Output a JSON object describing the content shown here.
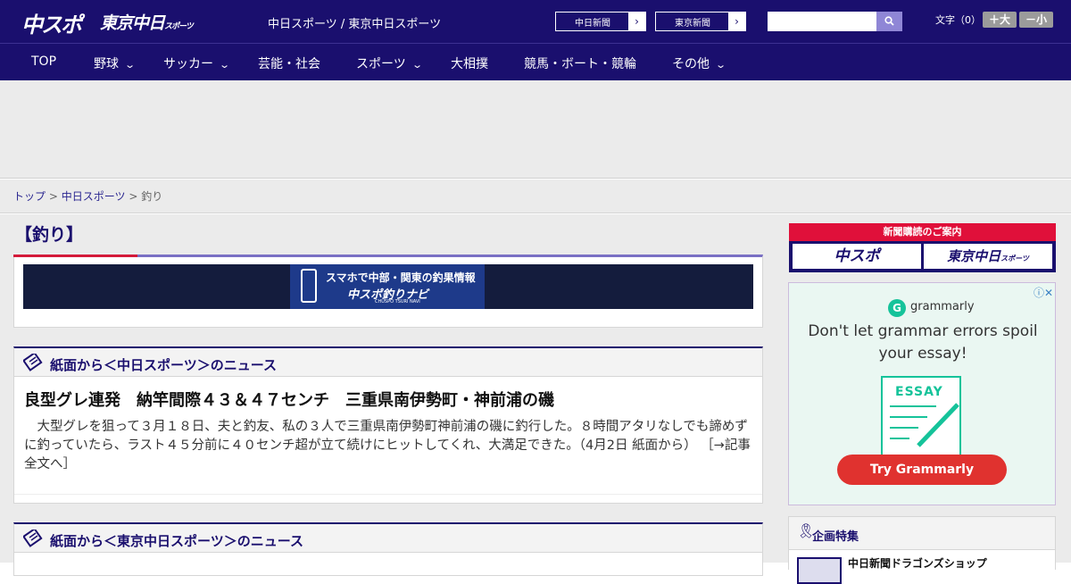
{
  "header": {
    "logo_primary": "中スポ",
    "logo_secondary": "東京中日",
    "logo_secondary_small": "スポーツ",
    "site_title": "中日スポーツ / 東京中日スポーツ",
    "external_links": [
      {
        "label": "中日新聞",
        "arrow": "›"
      },
      {
        "label": "東京新聞",
        "arrow": "›"
      }
    ],
    "search": {
      "placeholder": "",
      "value": ""
    },
    "font_size_label": "文字（0）",
    "font_larger_label": "＋大",
    "font_smaller_label": "－小"
  },
  "nav": {
    "items": [
      {
        "label": "TOP",
        "has_dropdown": false
      },
      {
        "label": "野球",
        "has_dropdown": true
      },
      {
        "label": "サッカー",
        "has_dropdown": true
      },
      {
        "label": "芸能・社会",
        "has_dropdown": false
      },
      {
        "label": "スポーツ",
        "has_dropdown": true
      },
      {
        "label": "大相撲",
        "has_dropdown": false
      },
      {
        "label": "競馬・ボート・競輪",
        "has_dropdown": false
      },
      {
        "label": "その他",
        "has_dropdown": true
      }
    ],
    "chevron": "⌄"
  },
  "breadcrumb": {
    "items": [
      "トップ",
      "中日スポーツ",
      "釣り"
    ],
    "separator": ">"
  },
  "category": {
    "title": "【釣り】"
  },
  "promo_banner": {
    "line1": "スマホで中部・関東の釣果情報",
    "line2": "中スポ釣りナビ",
    "line3": "CHUSPO TSURI NAVI"
  },
  "news_sections": [
    {
      "heading": "紙面から＜中日スポーツ＞のニュース",
      "headline": "良型グレ連発　納竿間際４３＆４７センチ　三重県南伊勢町・神前浦の磯",
      "lead": "　大型グレを狙って３月１８日、夫と釣友、私の３人で三重県南伊勢町神前浦の磯に釣行した。８時間アタリなしでも諦めずに釣っていたら、ラスト４５分前に４０センチ超が立て続けにヒットしてくれ、大満足できた。（4月2日 紙面から）",
      "more_link": "［→記事全文へ］"
    },
    {
      "heading": "紙面から＜東京中日スポーツ＞のニュース"
    }
  ],
  "sidebar": {
    "subscription": {
      "title": "新聞購読のご案内",
      "buttons": [
        "中スポ",
        "東京中日"
      ],
      "button2_small": "スポーツ"
    },
    "ad": {
      "brand": "grammarly",
      "brand_mark": "G",
      "message": "Don't let grammar errors spoil your essay!",
      "essay_label": "ESSAY",
      "cta": "Try Grammarly",
      "close": "ⓘ✕"
    },
    "feature": {
      "title": "企画特集",
      "item": "中日新聞ドラゴンズショップ"
    }
  },
  "colors": {
    "brand_navy": "#1a0f6e",
    "accent_red": "#d41a3a",
    "grammarly_green": "#15c39a",
    "grammarly_red": "#e0322f"
  }
}
